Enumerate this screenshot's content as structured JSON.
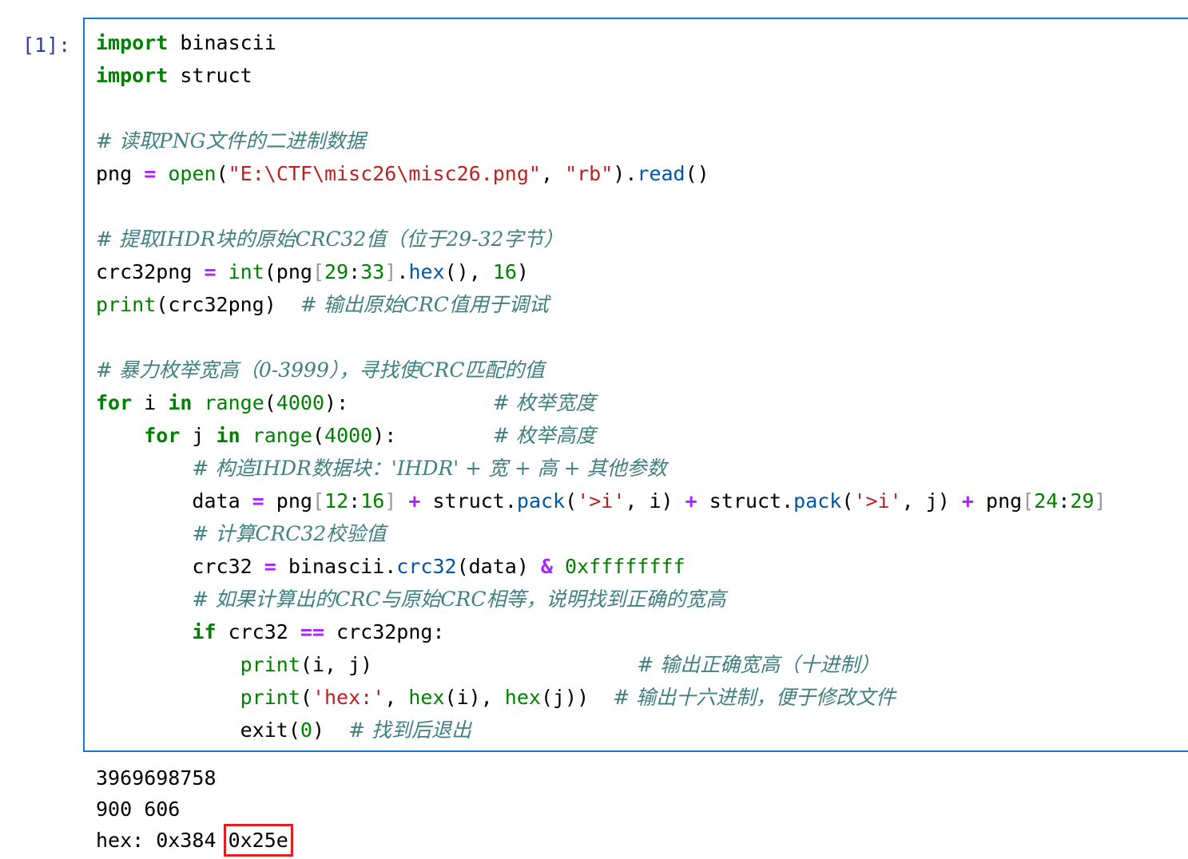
{
  "cell": {
    "prompt": "[1]:",
    "code_lines": [
      [
        {
          "t": "kw",
          "v": "import"
        },
        {
          "t": "p",
          "v": " binascii"
        }
      ],
      [
        {
          "t": "kw",
          "v": "import"
        },
        {
          "t": "p",
          "v": " struct"
        }
      ],
      [],
      [
        {
          "t": "cm",
          "v": "# 读取PNG文件的二进制数据"
        }
      ],
      [
        {
          "t": "p",
          "v": "png "
        },
        {
          "t": "op",
          "v": "="
        },
        {
          "t": "p",
          "v": " "
        },
        {
          "t": "bi",
          "v": "open"
        },
        {
          "t": "p",
          "v": "("
        },
        {
          "t": "st",
          "v": "\"E:\\CTF\\misc26\\misc26.png\""
        },
        {
          "t": "p",
          "v": ", "
        },
        {
          "t": "st",
          "v": "\"rb\""
        },
        {
          "t": "p",
          "v": ")."
        },
        {
          "t": "me",
          "v": "read"
        },
        {
          "t": "p",
          "v": "()"
        }
      ],
      [],
      [
        {
          "t": "cm",
          "v": "# 提取IHDR块的原始CRC32值（位于29-32字节）"
        }
      ],
      [
        {
          "t": "p",
          "v": "crc32png "
        },
        {
          "t": "op",
          "v": "="
        },
        {
          "t": "p",
          "v": " "
        },
        {
          "t": "bi",
          "v": "int"
        },
        {
          "t": "p",
          "v": "(png"
        },
        {
          "t": "br",
          "v": "["
        },
        {
          "t": "nu",
          "v": "29"
        },
        {
          "t": "p",
          "v": ":"
        },
        {
          "t": "nu",
          "v": "33"
        },
        {
          "t": "br",
          "v": "]"
        },
        {
          "t": "p",
          "v": "."
        },
        {
          "t": "me",
          "v": "hex"
        },
        {
          "t": "p",
          "v": "(), "
        },
        {
          "t": "nu",
          "v": "16"
        },
        {
          "t": "p",
          "v": ")"
        }
      ],
      [
        {
          "t": "bi",
          "v": "print"
        },
        {
          "t": "p",
          "v": "(crc32png)  "
        },
        {
          "t": "cm",
          "v": "# 输出原始CRC值用于调试"
        }
      ],
      [],
      [
        {
          "t": "cm",
          "v": "# 暴力枚举宽高（0-3999），寻找使CRC匹配的值"
        }
      ],
      [
        {
          "t": "kw",
          "v": "for"
        },
        {
          "t": "p",
          "v": " i "
        },
        {
          "t": "kw",
          "v": "in"
        },
        {
          "t": "p",
          "v": " "
        },
        {
          "t": "bi",
          "v": "range"
        },
        {
          "t": "p",
          "v": "("
        },
        {
          "t": "nu",
          "v": "4000"
        },
        {
          "t": "p",
          "v": "):            "
        },
        {
          "t": "cm",
          "v": "# 枚举宽度"
        }
      ],
      [
        {
          "t": "p",
          "v": "    "
        },
        {
          "t": "kw",
          "v": "for"
        },
        {
          "t": "p",
          "v": " j "
        },
        {
          "t": "kw",
          "v": "in"
        },
        {
          "t": "p",
          "v": " "
        },
        {
          "t": "bi",
          "v": "range"
        },
        {
          "t": "p",
          "v": "("
        },
        {
          "t": "nu",
          "v": "4000"
        },
        {
          "t": "p",
          "v": "):        "
        },
        {
          "t": "cm",
          "v": "# 枚举高度"
        }
      ],
      [
        {
          "t": "p",
          "v": "        "
        },
        {
          "t": "cm",
          "v": "# 构造IHDR数据块：'IHDR' + 宽 + 高 + 其他参数"
        }
      ],
      [
        {
          "t": "p",
          "v": "        data "
        },
        {
          "t": "op",
          "v": "="
        },
        {
          "t": "p",
          "v": " png"
        },
        {
          "t": "br",
          "v": "["
        },
        {
          "t": "nu",
          "v": "12"
        },
        {
          "t": "p",
          "v": ":"
        },
        {
          "t": "nu",
          "v": "16"
        },
        {
          "t": "br",
          "v": "]"
        },
        {
          "t": "p",
          "v": " "
        },
        {
          "t": "op",
          "v": "+"
        },
        {
          "t": "p",
          "v": " struct."
        },
        {
          "t": "me",
          "v": "pack"
        },
        {
          "t": "p",
          "v": "("
        },
        {
          "t": "st",
          "v": "'>i'"
        },
        {
          "t": "p",
          "v": ", i) "
        },
        {
          "t": "op",
          "v": "+"
        },
        {
          "t": "p",
          "v": " struct."
        },
        {
          "t": "me",
          "v": "pack"
        },
        {
          "t": "p",
          "v": "("
        },
        {
          "t": "st",
          "v": "'>i'"
        },
        {
          "t": "p",
          "v": ", j) "
        },
        {
          "t": "op",
          "v": "+"
        },
        {
          "t": "p",
          "v": " png"
        },
        {
          "t": "br",
          "v": "["
        },
        {
          "t": "nu",
          "v": "24"
        },
        {
          "t": "p",
          "v": ":"
        },
        {
          "t": "nu",
          "v": "29"
        },
        {
          "t": "br",
          "v": "]"
        }
      ],
      [
        {
          "t": "p",
          "v": "        "
        },
        {
          "t": "cm",
          "v": "# 计算CRC32校验值"
        }
      ],
      [
        {
          "t": "p",
          "v": "        crc32 "
        },
        {
          "t": "op",
          "v": "="
        },
        {
          "t": "p",
          "v": " binascii."
        },
        {
          "t": "me",
          "v": "crc32"
        },
        {
          "t": "p",
          "v": "(data) "
        },
        {
          "t": "op",
          "v": "&"
        },
        {
          "t": "p",
          "v": " "
        },
        {
          "t": "nu",
          "v": "0xffffffff"
        }
      ],
      [
        {
          "t": "p",
          "v": "        "
        },
        {
          "t": "cm",
          "v": "# 如果计算出的CRC与原始CRC相等，说明找到正确的宽高"
        }
      ],
      [
        {
          "t": "p",
          "v": "        "
        },
        {
          "t": "kw",
          "v": "if"
        },
        {
          "t": "p",
          "v": " crc32 "
        },
        {
          "t": "op",
          "v": "=="
        },
        {
          "t": "p",
          "v": " crc32png:"
        }
      ],
      [
        {
          "t": "p",
          "v": "            "
        },
        {
          "t": "bi",
          "v": "print"
        },
        {
          "t": "p",
          "v": "(i, j)                      "
        },
        {
          "t": "cm",
          "v": "# 输出正确宽高（十进制）"
        }
      ],
      [
        {
          "t": "p",
          "v": "            "
        },
        {
          "t": "bi",
          "v": "print"
        },
        {
          "t": "p",
          "v": "("
        },
        {
          "t": "st",
          "v": "'hex:'"
        },
        {
          "t": "p",
          "v": ", "
        },
        {
          "t": "bi",
          "v": "hex"
        },
        {
          "t": "p",
          "v": "(i), "
        },
        {
          "t": "bi",
          "v": "hex"
        },
        {
          "t": "p",
          "v": "(j))  "
        },
        {
          "t": "cm",
          "v": "# 输出十六进制，便于修改文件"
        }
      ],
      [
        {
          "t": "p",
          "v": "            exit("
        },
        {
          "t": "nu",
          "v": "0"
        },
        {
          "t": "p",
          "v": ")  "
        },
        {
          "t": "cm",
          "v": "# 找到后退出"
        }
      ]
    ]
  },
  "output": {
    "lines": [
      [
        {
          "t": "p",
          "v": "3969698758"
        }
      ],
      [
        {
          "t": "p",
          "v": "900 606"
        }
      ],
      [
        {
          "t": "p",
          "v": "hex: 0x384 "
        },
        {
          "t": "hl",
          "v": "0x25e"
        }
      ]
    ],
    "highlight_color": "#e02020"
  },
  "colors": {
    "keyword": "#008000",
    "string": "#ba2121",
    "comment": "#408080",
    "operator": "#aa22ff",
    "method": "#0055aa",
    "cell_border": "#1976d2",
    "prompt": "#303f9f"
  }
}
